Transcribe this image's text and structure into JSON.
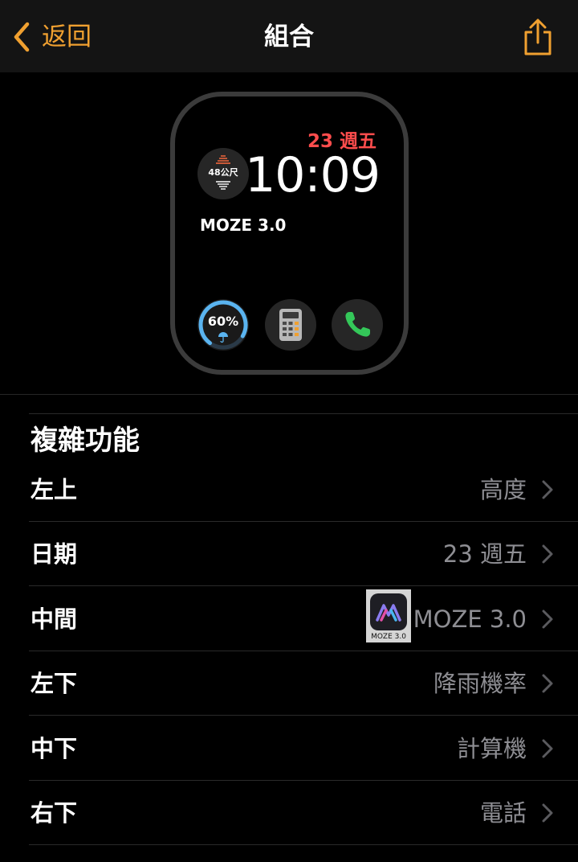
{
  "nav": {
    "back_label": "返回",
    "title": "組合"
  },
  "watch_face": {
    "date": "23 週五",
    "time": "10:09",
    "altitude": "48公尺",
    "middle_text": "MOZE 3.0",
    "rain_chance": "60%"
  },
  "section": {
    "title": "複雜功能"
  },
  "rows": [
    {
      "label": "左上",
      "value": "高度"
    },
    {
      "label": "日期",
      "value": "23 週五"
    },
    {
      "label": "中間",
      "value": "MOZE 3.0",
      "icon_caption": "MOZE 3.0"
    },
    {
      "label": "左下",
      "value": "降雨機率"
    },
    {
      "label": "中下",
      "value": "計算機"
    },
    {
      "label": "右下",
      "value": "電話"
    }
  ],
  "colors": {
    "accent": "#f0a030",
    "date_red": "#ff4d4d",
    "secondary_text": "#8e8e93",
    "phone_green": "#34c759",
    "rain_ring": "#5ab4f0"
  },
  "icons": [
    "chevron-left-icon",
    "share-icon",
    "altitude-icon",
    "umbrella-icon",
    "calculator-icon",
    "phone-icon",
    "moze-app-icon",
    "chevron-right-icon"
  ]
}
